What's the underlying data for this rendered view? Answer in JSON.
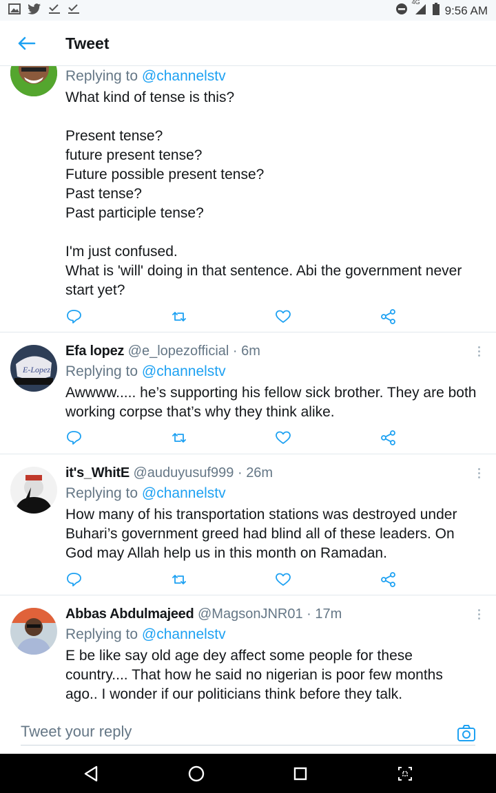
{
  "status_bar": {
    "time": "9:56 AM",
    "network": "4G"
  },
  "header": {
    "title": "Tweet"
  },
  "tweets": [
    {
      "name": "",
      "handle": "",
      "time": "",
      "replying_prefix": "Replying to ",
      "replying_to": "@channelstv",
      "text": "What kind of tense is this?\n\nPresent tense?\nfuture present tense?\nFuture possible present tense?\nPast tense?\nPast participle tense?\n\nI'm just confused.\nWhat is 'will' doing in that sentence. Abi the government never start yet?"
    },
    {
      "name": "Efa lopez",
      "handle": "@e_lopezofficial",
      "time": "6m",
      "replying_prefix": "Replying to ",
      "replying_to": "@channelstv",
      "text": "Awwww..... he’s supporting his fellow sick brother. They are both working corpse that’s why they think alike."
    },
    {
      "name": "it's_WhitE",
      "handle": "@auduyusuf999",
      "time": "26m",
      "replying_prefix": "Replying to ",
      "replying_to": "@channelstv",
      "text": "How many of his transportation stations was destroyed under Buhari’s government greed had blind all of these leaders. On God may Allah help us in this month on Ramadan."
    },
    {
      "name": "Abbas Abdulmajeed",
      "handle": "@MagsonJNR01",
      "time": "17m",
      "replying_prefix": "Replying to ",
      "replying_to": "@channelstv",
      "text": "E be like say old age dey affect some people for these country.... That how he said no nigerian is poor few months ago.. I wonder if our politicians think before they talk."
    }
  ],
  "separator": " · ",
  "reply_bar": {
    "placeholder": "Tweet your reply"
  },
  "icons": {
    "back": "arrow-left-icon",
    "reply": "reply-bubble-icon",
    "retweet": "retweet-icon",
    "like": "heart-icon",
    "share": "share-icon",
    "camera": "camera-icon",
    "more": "more-vertical-icon"
  },
  "colors": {
    "accent": "#1da1f2",
    "secondary_text": "#657786",
    "divider": "#e1e8ed"
  }
}
